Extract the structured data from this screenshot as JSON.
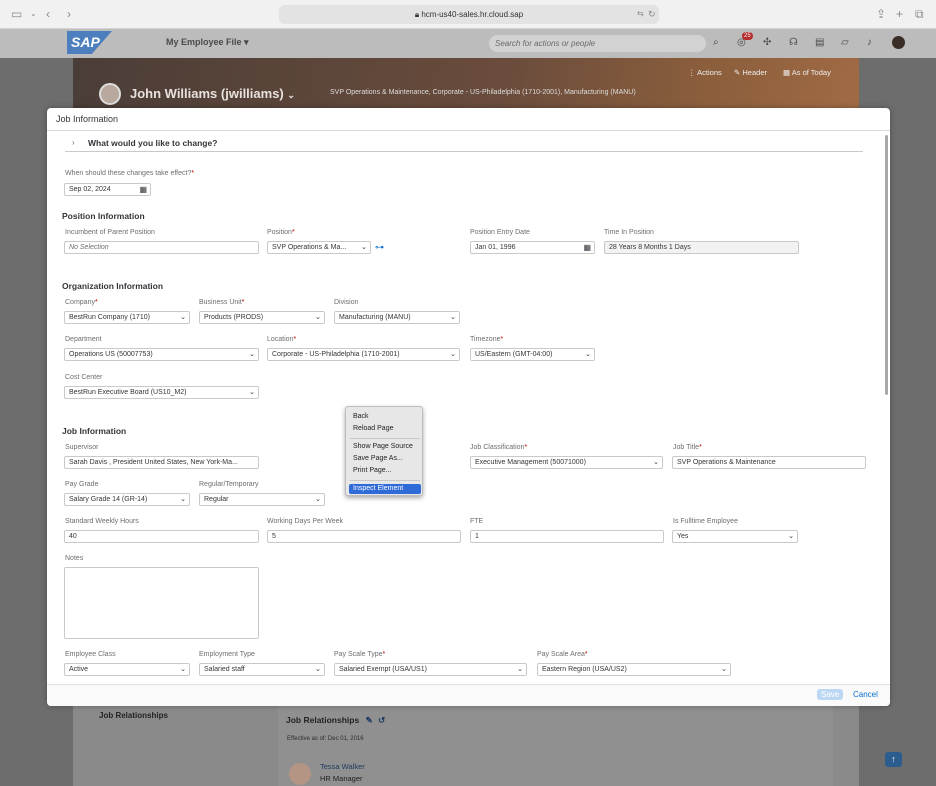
{
  "browser": {
    "url": "hcm-us40-sales.hr.cloud.sap"
  },
  "shell": {
    "logo": "SAP",
    "app_title": "My Employee File",
    "search_placeholder": "Search for actions or people",
    "notification_count": "25"
  },
  "profile": {
    "name": "John Williams (jwilliams)",
    "subtitle": "SVP Operations & Maintenance, Corporate - US-Philadelphia (1710-2001), Manufacturing (MANU)",
    "actions": [
      "Actions",
      "Header",
      "As of Today"
    ]
  },
  "dialog": {
    "title": "Job Information",
    "change_prompt": "What would you like to change?",
    "effective_label": "When should these changes take effect?",
    "effective_date": "Sep 02, 2024",
    "position_section": "Position Information",
    "position": {
      "incumbent_label": "Incumbent of Parent Position",
      "incumbent_value": "No Selection",
      "position_label": "Position",
      "position_value": "SVP Operations & Ma...",
      "entry_date_label": "Position Entry Date",
      "entry_date_value": "Jan 01, 1996",
      "time_label": "Time In Position",
      "time_value": "28 Years 8 Months 1 Days"
    },
    "org_section": "Organization Information",
    "org": {
      "company_label": "Company",
      "company_value": "BestRun Company (1710)",
      "bu_label": "Business Unit",
      "bu_value": "Products (PRODS)",
      "division_label": "Division",
      "division_value": "Manufacturing (MANU)",
      "department_label": "Department",
      "department_value": "Operations US (50007753)",
      "location_label": "Location",
      "location_value": "Corporate - US-Philadelphia (1710-2001)",
      "timezone_label": "Timezone",
      "timezone_value": "US/Eastern (GMT-04:00)",
      "cost_center_label": "Cost Center",
      "cost_center_value": "BestRun Executive Board (US10_M2)"
    },
    "job_section": "Job Information",
    "job": {
      "supervisor_label": "Supervisor",
      "supervisor_value": "Sarah Davis , President United States, New York-Ma...",
      "classification_label": "Job Classification",
      "classification_value": "Executive Management (50071000)",
      "title_label": "Job Title",
      "title_value": "SVP Operations & Maintenance",
      "pay_grade_label": "Pay Grade",
      "pay_grade_value": "Salary Grade 14 (GR-14)",
      "reg_temp_label": "Regular/Temporary",
      "reg_temp_value": "Regular",
      "weekly_hours_label": "Standard Weekly Hours",
      "weekly_hours_value": "40",
      "working_days_label": "Working Days Per Week",
      "working_days_value": "5",
      "fte_label": "FTE",
      "fte_value": "1",
      "fulltime_label": "Is Fulltime Employee",
      "fulltime_value": "Yes",
      "notes_label": "Notes",
      "emp_class_label": "Employee Class",
      "emp_class_value": "Active",
      "emp_type_label": "Employment Type",
      "emp_type_value": "Salaried staff",
      "pay_scale_type_label": "Pay Scale Type",
      "pay_scale_type_value": "Salaried Exempt (USA/US1)",
      "pay_scale_area_label": "Pay Scale Area",
      "pay_scale_area_value": "Eastern Region (USA/US2)"
    },
    "save_label": "Save",
    "cancel_label": "Cancel"
  },
  "context_menu": {
    "items": [
      "Back",
      "Reload Page",
      "Show Page Source",
      "Save Page As...",
      "Print Page...",
      "Inspect Element"
    ]
  },
  "job_relationships": {
    "side_title": "Job Relationships",
    "card_title": "Job Relationships",
    "effective": "Effective as of: Dec 01, 2016",
    "person_name": "Tessa Walker",
    "person_role": "HR Manager"
  },
  "colors": {
    "accent": "#0a6ed1",
    "required": "#bb0000",
    "menu_highlight": "#2f6bd8"
  }
}
